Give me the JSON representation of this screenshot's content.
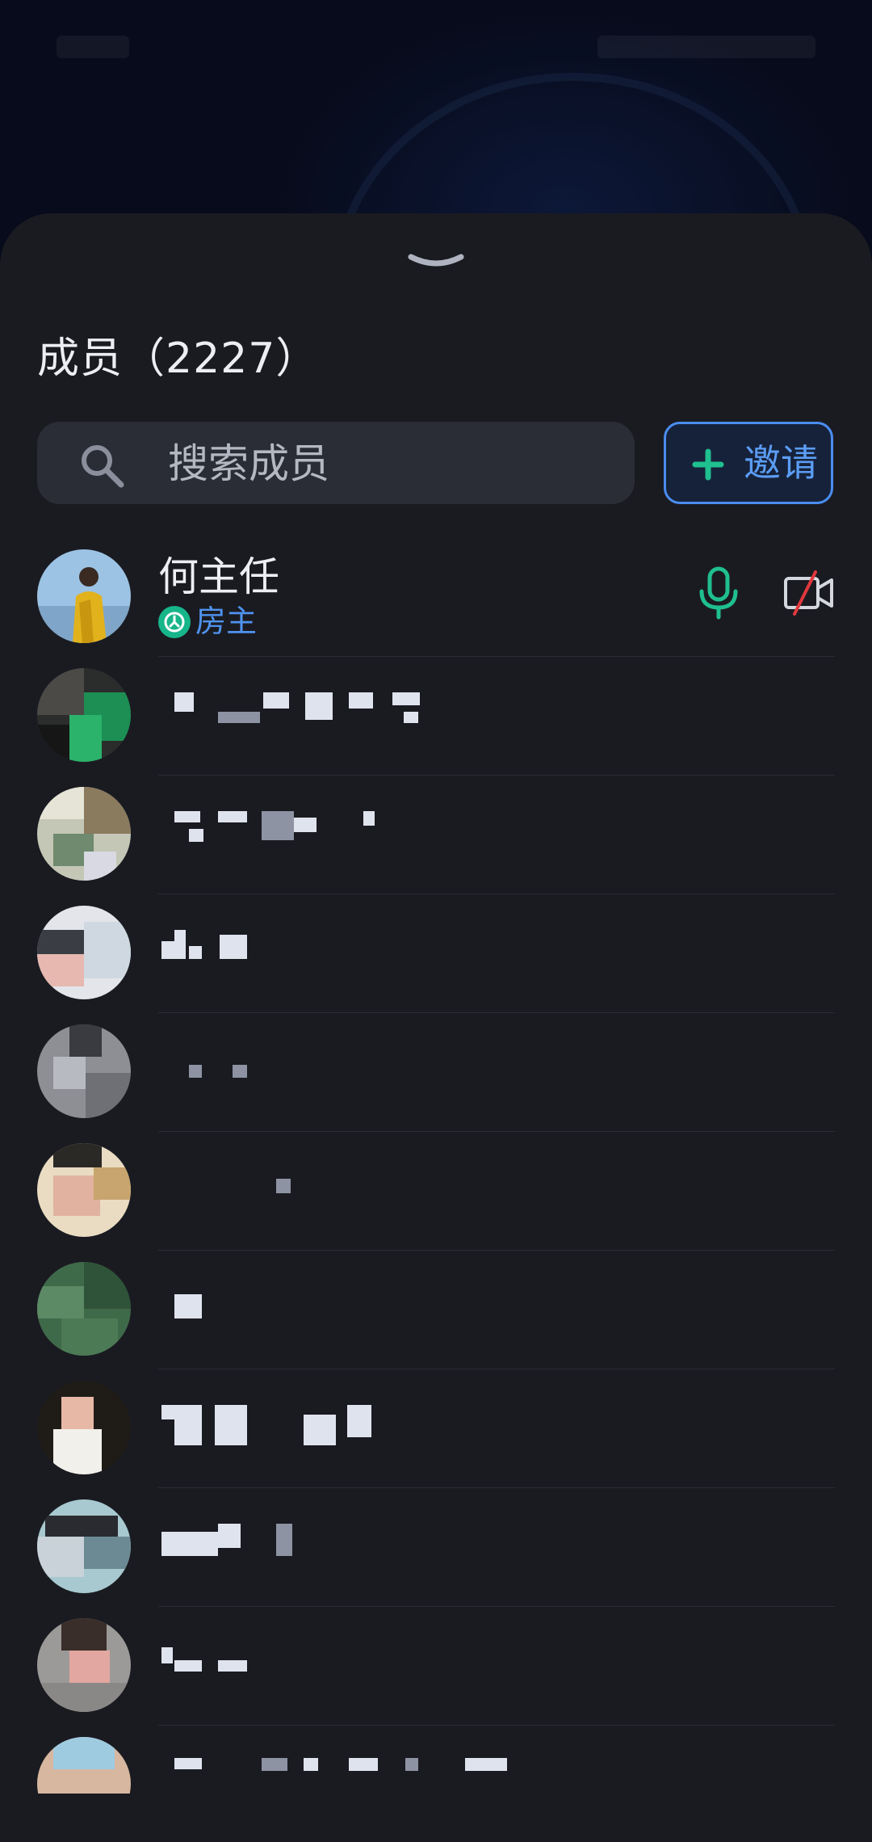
{
  "sheet": {
    "title": "成员（2227）"
  },
  "search": {
    "placeholder": "搜索成员"
  },
  "invite": {
    "label": "邀请"
  },
  "members": [
    {
      "name": "何主任",
      "role": "房主",
      "mic": "on",
      "camera": "off"
    }
  ],
  "colors": {
    "accent_blue": "#4f93ee",
    "mic_green": "#1fbf8f",
    "camera_off_red": "#e0383e",
    "sheet_bg": "#1a1b21"
  },
  "icons": {
    "search": "search-icon",
    "invite": "plus-icon",
    "host": "host-badge-icon",
    "mic": "microphone-icon",
    "camera": "camera-off-icon",
    "collapse": "chevron-down-icon"
  }
}
